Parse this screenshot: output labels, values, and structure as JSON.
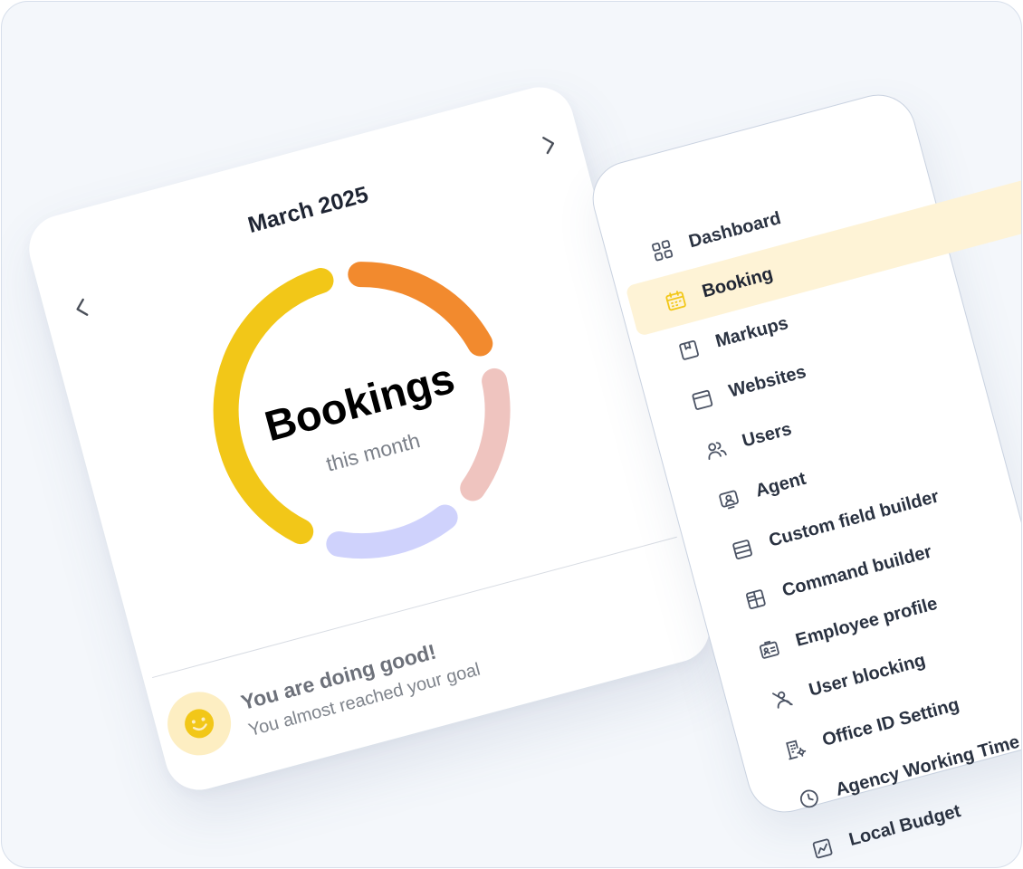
{
  "card": {
    "month": "March 2025",
    "title": "Bookings",
    "subtitle": "this month",
    "message_title": "You are doing good!",
    "message_sub": "You almost reached your goal"
  },
  "chart_data": {
    "type": "donut",
    "title": "Bookings",
    "subtitle": "this month",
    "segments": [
      {
        "color": "#f28a2e",
        "value": 18
      },
      {
        "color": "#efc4bf",
        "value": 14
      },
      {
        "color": "#cfd2fc",
        "value": 14
      },
      {
        "color": "#f2c718",
        "value": 40
      }
    ]
  },
  "menu": {
    "items": [
      {
        "label": "Dashboard",
        "icon": "dashboard-icon",
        "active": false
      },
      {
        "label": "Booking",
        "icon": "calendar-icon",
        "active": true
      },
      {
        "label": "Markups",
        "icon": "bookmark-icon",
        "active": false
      },
      {
        "label": "Websites",
        "icon": "browser-window-icon",
        "active": false
      },
      {
        "label": "Users",
        "icon": "users-icon",
        "active": false
      },
      {
        "label": "Agent",
        "icon": "agent-icon",
        "active": false
      },
      {
        "label": "Custom field builder",
        "icon": "list-rows-icon",
        "active": false
      },
      {
        "label": "Command builder",
        "icon": "table-grid-icon",
        "active": false
      },
      {
        "label": "Employee profile",
        "icon": "id-badge-icon",
        "active": false
      },
      {
        "label": "User blocking",
        "icon": "user-block-icon",
        "active": false
      },
      {
        "label": "Office ID Setting",
        "icon": "building-settings-icon",
        "active": false
      },
      {
        "label": "Agency Working Time",
        "icon": "clock-icon",
        "active": false
      },
      {
        "label": "Local Budget",
        "icon": "chart-icon",
        "active": false
      }
    ]
  },
  "colors": {
    "accent_active_bg": "#fef3d6",
    "accent_active_icon": "#f2c718",
    "text_dark": "#2a3241",
    "muted": "#7b8089"
  }
}
